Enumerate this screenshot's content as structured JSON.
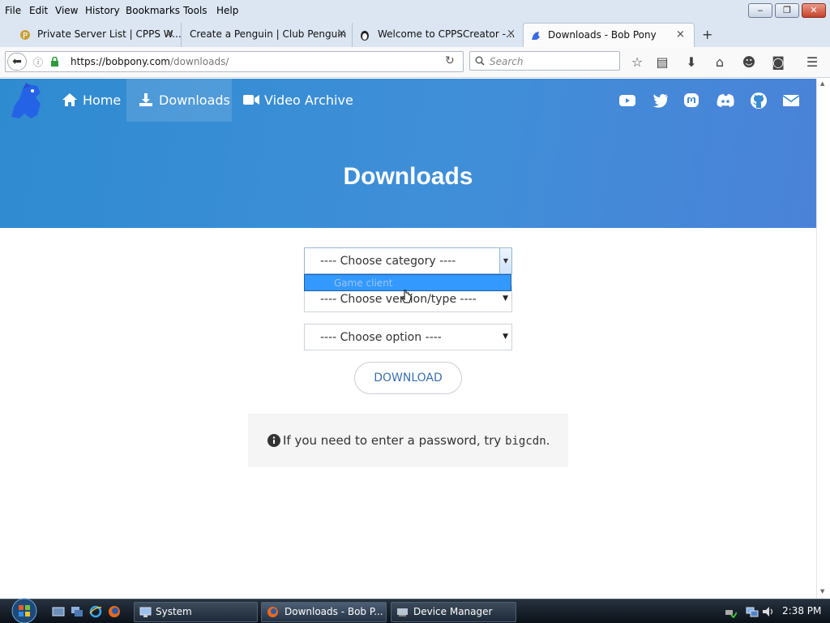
{
  "menu": {
    "items": [
      "File",
      "Edit",
      "View",
      "History",
      "Bookmarks",
      "Tools",
      "Help"
    ]
  },
  "window_controls": {
    "minimize": "‒",
    "restore": "❐",
    "close": "✕"
  },
  "tabs": [
    {
      "title": "Private Server List | CPPS W...",
      "close": "×"
    },
    {
      "title": "Create a Penguin | Club Penguin",
      "close": "×"
    },
    {
      "title": "Welcome to CPPSCreator -...",
      "close": "×"
    },
    {
      "title": "Downloads - Bob Pony",
      "close": "×"
    }
  ],
  "new_tab": "+",
  "navbar": {
    "url_host": "https://bobpony.com",
    "url_path": "/downloads/",
    "search_placeholder": "Search"
  },
  "site": {
    "nav": [
      {
        "label": "Home",
        "icon": "home-icon"
      },
      {
        "label": "Downloads",
        "icon": "download-icon"
      },
      {
        "label": "Video Archive",
        "icon": "video-camera-icon"
      }
    ],
    "social_icons": [
      "youtube-icon",
      "twitter-icon",
      "mastodon-icon",
      "discord-icon",
      "github-icon",
      "email-icon"
    ],
    "heading": "Downloads",
    "header_gradient": [
      "#2f8bd0",
      "#4a82d8"
    ]
  },
  "form": {
    "category_select": "---- Choose category ----",
    "dropdown_option": "Game client",
    "version_select": "---- Choose version/type ----",
    "option_select": "---- Choose option ----",
    "download_button": "DOWNLOAD"
  },
  "info": {
    "text_before": "If you need to enter a password, try",
    "password": "bigcdn",
    "text_after": "."
  },
  "taskbar": {
    "buttons": [
      {
        "label": "System"
      },
      {
        "label": "Downloads - Bob P..."
      },
      {
        "label": "Device Manager"
      }
    ],
    "clock": "2:38 PM"
  }
}
